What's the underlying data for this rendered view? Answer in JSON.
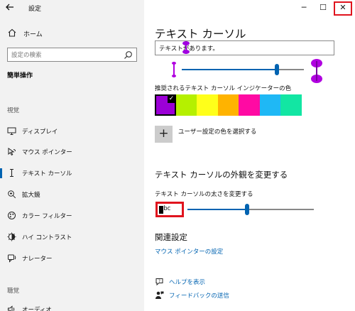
{
  "window": {
    "title": "設定",
    "controls": {
      "minimize": "─",
      "maximize": "☐",
      "close": "✕"
    }
  },
  "sidebar": {
    "home_label": "ホーム",
    "search_placeholder": "設定の検索",
    "section_heading": "簡単操作",
    "group_vision": "視覚",
    "group_hearing": "聴覚",
    "items": [
      {
        "label": "ディスプレイ",
        "icon": "monitor-icon"
      },
      {
        "label": "マウス ポインター",
        "icon": "mouse-pointer-icon"
      },
      {
        "label": "テキスト カーソル",
        "icon": "text-cursor-icon",
        "selected": true
      },
      {
        "label": "拡大鏡",
        "icon": "magnifier-icon"
      },
      {
        "label": "カラー フィルター",
        "icon": "color-filter-icon"
      },
      {
        "label": "ハイ コントラスト",
        "icon": "high-contrast-icon"
      },
      {
        "label": "ナレーター",
        "icon": "narrator-icon"
      },
      {
        "label": "オーディオ",
        "icon": "audio-icon"
      }
    ]
  },
  "main": {
    "page_title": "テキスト カーソル",
    "preview_text": "テキストがあります。",
    "indicator_size_level": 0.78,
    "colors_label": "推奨されるテキスト カーソル インジケーターの色",
    "swatches": [
      {
        "color": "#9b00d6",
        "selected": true
      },
      {
        "color": "#b5f000",
        "selected": false
      },
      {
        "color": "#ffff1a",
        "selected": false
      },
      {
        "color": "#ffb300",
        "selected": false
      },
      {
        "color": "#ff0aa3",
        "selected": false
      },
      {
        "color": "#1fb8f5",
        "selected": false
      },
      {
        "color": "#12e6a3",
        "selected": false
      }
    ],
    "custom_color_label": "ユーザー設定の色を選択する",
    "appearance_title": "テキスト カーソルの外観を変更する",
    "thickness_label": "テキスト カーソルの太さを変更する",
    "thickness_preview": "abc",
    "thickness_level": 0.47,
    "related_title": "関連設定",
    "related_link": "マウス ポインターの設定",
    "help_label": "ヘルプを表示",
    "feedback_label": "フィードバックの送信"
  },
  "colors": {
    "accent": "#0063b1",
    "highlight": "#e0141e",
    "cursor_purple": "#a000e0"
  }
}
